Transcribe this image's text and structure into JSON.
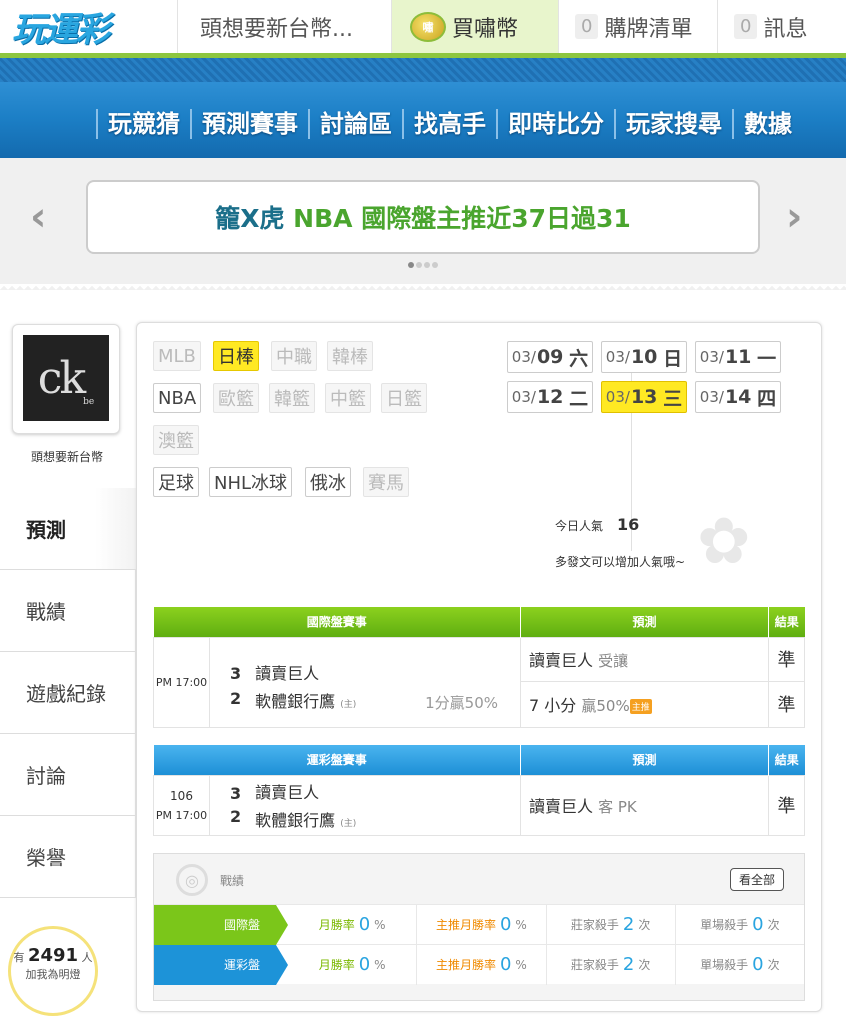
{
  "header": {
    "logo_text": "玩運彩",
    "user_name": "頭想要新台幣...",
    "buy_coin_badge": "嘯",
    "buy_coin_label": "買嘯幣",
    "cart_count": "0",
    "cart_label": "購牌清單",
    "msg_count": "0",
    "msg_label": "訊息"
  },
  "nav": {
    "items": [
      "玩競猜",
      "預測賽事",
      "討論區",
      "找高手",
      "即時比分",
      "玩家搜尋",
      "數據"
    ]
  },
  "banner": {
    "prefix": "籠X虎",
    "text": " NBA 國際盤主推近37日過31",
    "prev_arrow": "‹",
    "next_arrow": "›"
  },
  "sidebar": {
    "avatar_text": "ck",
    "avatar_subtext": "be",
    "user_name": "頭想要新台幣",
    "menu": [
      "預測",
      "戰績",
      "遊戲紀錄",
      "討論",
      "榮譽"
    ],
    "fans_prefix": "有",
    "fans_count": "2491",
    "fans_unit": "人",
    "fans_action": "加我為明燈"
  },
  "sports": {
    "row1": [
      "MLB",
      "日棒",
      "中職",
      "韓棒"
    ],
    "row2": [
      "NBA",
      "歐籃",
      "韓籃",
      "中籃",
      "日籃"
    ],
    "row3": [
      "澳籃"
    ],
    "row4": [
      "足球",
      "NHL冰球",
      "俄冰",
      "賽馬"
    ]
  },
  "dates": [
    {
      "md": "03/",
      "d": "09",
      "w": "六"
    },
    {
      "md": "03/",
      "d": "10",
      "w": "日"
    },
    {
      "md": "03/",
      "d": "11",
      "w": "一"
    },
    {
      "md": "03/",
      "d": "12",
      "w": "二"
    },
    {
      "md": "03/",
      "d": "13",
      "w": "三"
    },
    {
      "md": "03/",
      "d": "14",
      "w": "四"
    }
  ],
  "popularity": {
    "label": "今日人氣",
    "value": "16",
    "tip": "多發文可以增加人氣哦~"
  },
  "intl_table": {
    "headers": [
      "國際盤賽事",
      "預測",
      "結果"
    ],
    "time": "PM 17:00",
    "team1_score": "3",
    "team1": "讀賣巨人",
    "team2_score": "2",
    "team2": "軟體銀行鷹",
    "host_mark": "(主)",
    "handicap": "1分贏50%",
    "pred1_team": "讀賣巨人",
    "pred1_note": "受讓",
    "pred1_result": "準",
    "pred2_main": "7 小分",
    "pred2_note": "贏50%",
    "pred2_tag": "主推",
    "pred2_result": "準"
  },
  "sport_table": {
    "headers": [
      "運彩盤賽事",
      "預測",
      "結果"
    ],
    "game_no": "106",
    "time": "PM 17:00",
    "team1_score": "3",
    "team1": "讀賣巨人",
    "team2_score": "2",
    "team2": "軟體銀行鷹",
    "host_mark": "(主)",
    "pred_team": "讀賣巨人",
    "pred_note": "客 PK",
    "result": "準"
  },
  "record": {
    "title": "戰績",
    "view_all": "看全部",
    "rows": [
      {
        "label": "國際盤",
        "month_rate": "0",
        "main_rate": "0",
        "banker": "2",
        "single": "0"
      },
      {
        "label": "運彩盤",
        "month_rate": "0",
        "main_rate": "0",
        "banker": "2",
        "single": "0"
      }
    ],
    "month_label": "月勝率",
    "main_label": "主推月勝率",
    "banker_label": "莊家殺手",
    "single_label": "單場殺手",
    "pct": "%",
    "times": "次"
  }
}
